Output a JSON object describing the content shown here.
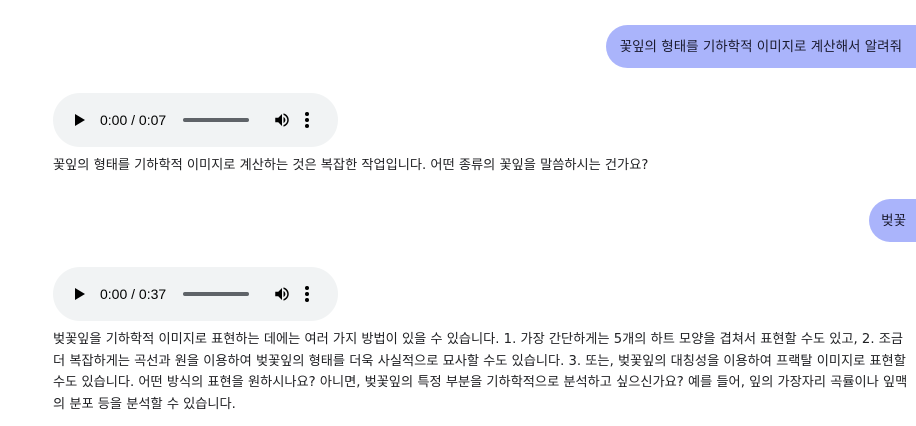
{
  "conversation": {
    "user_message_1": "꽃잎의 형태를 기하학적 이미지로 계산해서 알려줘",
    "bot_audio_1": {
      "time": "0:00 / 0:07",
      "progress": 0
    },
    "bot_text_1": "꽃잎의 형태를 기하학적 이미지로 계산하는 것은 복잡한 작업입니다. 어떤 종류의 꽃잎을 말씀하시는 건가요?",
    "user_message_2": "벚꽃",
    "bot_audio_2": {
      "time": "0:00 / 0:37",
      "progress": 0
    },
    "bot_text_2": "벚꽃잎을 기하학적 이미지로 표현하는 데에는 여러 가지 방법이 있을 수 있습니다. 1. 가장 간단하게는 5개의 하트 모양을 겹쳐서 표현할 수도 있고, 2. 조금 더 복잡하게는 곡선과 원을 이용하여 벚꽃잎의 형태를 더욱 사실적으로 묘사할 수도 있습니다. 3. 또는, 벚꽃잎의 대칭성을 이용하여 프랙탈 이미지로 표현할 수도 있습니다. 어떤 방식의 표현을 원하시나요? 아니면, 벚꽃잎의 특정 부분을 기하학적으로 분석하고 싶으신가요? 예를 들어, 잎의 가장자리 곡률이나 잎맥의 분포 등을 분석할 수 있습니다."
  },
  "colors": {
    "user_bubble": "#aab4fb",
    "audio_bg": "#f1f3f4",
    "text": "#202124"
  },
  "icons": {
    "play": "play-icon",
    "volume": "volume-icon",
    "more": "more-vert-icon"
  }
}
